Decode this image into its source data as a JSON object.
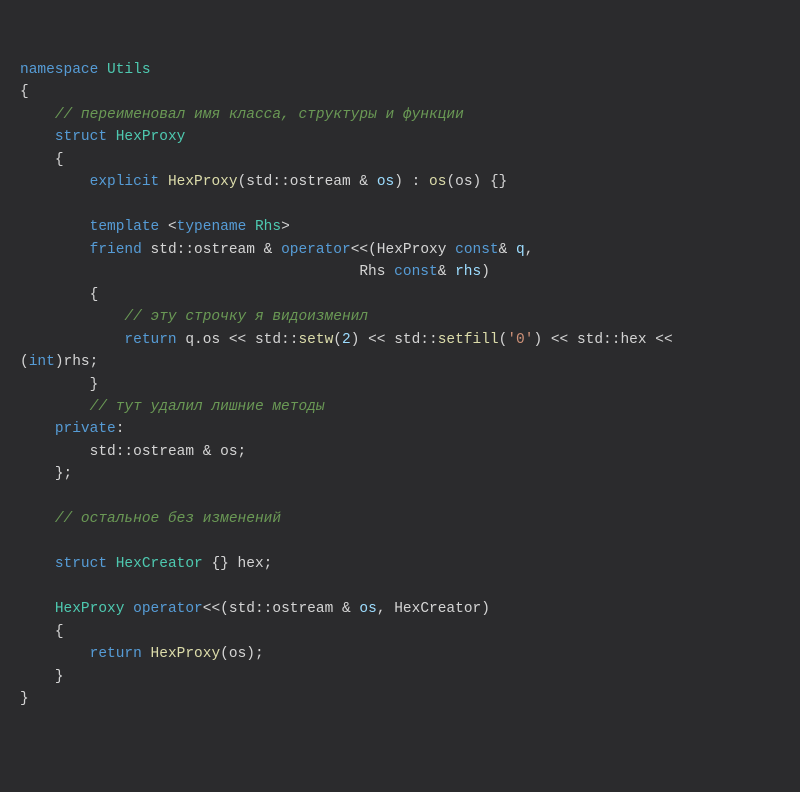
{
  "code": {
    "l1": {
      "kw": "namespace",
      "name": "Utils"
    },
    "l2": "{",
    "l3": {
      "indent": "    ",
      "comment": "// переименовал имя класса, структуры и функции"
    },
    "l4": {
      "indent": "    ",
      "kw": "struct",
      "name": "HexProxy"
    },
    "l5": {
      "indent": "    ",
      "brace": "{"
    },
    "l6": {
      "indent": "        ",
      "kw": "explicit",
      "fn": "HexProxy",
      "sig1": "(std::ostream & ",
      "p1": "os",
      "sig2": ") : ",
      "fn2": "os",
      "sig3": "(os) {}"
    },
    "l7": "",
    "l8": {
      "indent": "        ",
      "kw1": "template",
      "a1": " <",
      "kw2": "typename",
      "sp": " ",
      "t": "Rhs",
      "a2": ">"
    },
    "l9": {
      "indent": "        ",
      "kw": "friend",
      "ret": " std::ostream & ",
      "kw2": "operator",
      "op": "<<(HexProxy ",
      "kw3": "const",
      "amp": "& ",
      "p": "q",
      "comma": ","
    },
    "l10": {
      "indent": "                                       Rhs ",
      "kw": "const",
      "amp": "& ",
      "p": "rhs",
      "close": ")"
    },
    "l11": {
      "indent": "        ",
      "brace": "{"
    },
    "l12": {
      "indent": "            ",
      "comment": "// эту строчку я видоизменил"
    },
    "l13": {
      "indent": "            ",
      "kw": "return",
      "t1": " q.os << std::",
      "fn1": "setw",
      "t2": "(",
      "n1": "2",
      "t3": ") << std::",
      "fn2": "setfill",
      "t4": "(",
      "s": "'0'",
      "t5": ") << std::hex << "
    },
    "l13b": {
      "t6": "(",
      "kw2": "int",
      "t7": ")rhs;"
    },
    "l14": {
      "indent": "        ",
      "brace": "}"
    },
    "l15": {
      "indent": "        ",
      "comment": "// тут удалил лишние методы"
    },
    "l16": {
      "indent": "    ",
      "kw": "private",
      "colon": ":"
    },
    "l17": {
      "indent": "        ",
      "t": "std::ostream & os;"
    },
    "l18": {
      "indent": "    ",
      "brace": "};"
    },
    "l19": "",
    "l20": {
      "indent": "    ",
      "comment": "// остальное без изменений"
    },
    "l21": "",
    "l22": {
      "indent": "    ",
      "kw": "struct",
      "name": "HexCreator",
      "rest": " {} hex;"
    },
    "l23": "",
    "l24": {
      "indent": "    ",
      "ret": "HexProxy ",
      "kw": "operator",
      "op": "<<(std::ostream & ",
      "p1": "os",
      "c": ", HexCreator)"
    },
    "l25": {
      "indent": "    ",
      "brace": "{"
    },
    "l26": {
      "indent": "        ",
      "kw": "return",
      "sp": " ",
      "fn": "HexProxy",
      "args": "(os);"
    },
    "l27": {
      "indent": "    ",
      "brace": "}"
    },
    "l28": "}"
  }
}
